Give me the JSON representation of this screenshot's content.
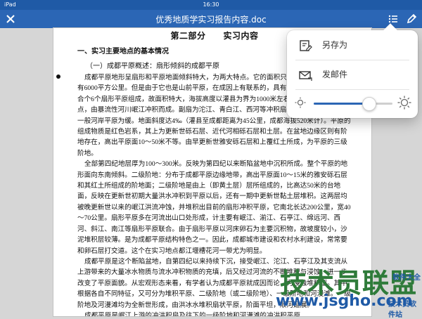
{
  "status_bar": {
    "left": "iPad",
    "time": "16:30",
    "right": ""
  },
  "header": {
    "doc_title": "优秀地质学实习报告内容.doc",
    "icons": [
      "close-icon",
      "list-icon",
      "edit-icon"
    ]
  },
  "document": {
    "part_title": "第二部分　　实习内容",
    "section_title": "一、实习主要地点的基本情况",
    "subsection_title": "（一）成都平原概述：扇形倾斜的成都平原",
    "paragraphs": [
      "成都平原地形呈扇形和平原地面倾斜特大，为两大特点。它的面积只有6000平方公里，只有6000平方公里。但是由于它也是山前平原，在成因上有联系的，具有扇形性质。并且是联合个6个扇形平原组成，故面积特大，海拔高度以灌县为界为1000米左右，西部以灌县县为顶点，由暴流性河川岷江冲积而成。副扇为沱江、青白江、西河等冲积扇组成的，扇形地势较一般河岸平原为缓。地面斜度达4‰（灌县至成都距离为45公里，成都海拔520米计）。平原的组成物质是红色岩系，其上为更新世砾石层、近代河相砾石层和土层。在盆地边缘区则有阶地存在，高出平原面10～50米不等。由早更新世雅安砾石层和上覆红土所成，为平原的三级阶地。",
      "全部第四纪地层厚为100～300米。反映为第四纪以来断陷盆地中沉积所成。整个平原的地形面向东南倾斜。二级阶地：分布于成都平原边缘地带，高出平原面10～15米的雅安砾石层和其红土所组成的阶地面；二级阶地是由上（即黄土层）层所组成的，比高达50米的台地面，反映在更新世初期大量洪水冲积到平原以后，还有一期中更新世黏土层堆积。这两层均被晚更新世以来的岷江洪流冲蚀，并堆积出目前的扇形冲积平原，它南北长达200公里，宽40～70公里。扇形平原多在河流出山口处形成，计主要有岷江、湔江、石亭江、绵远河、西河、斜江、南江等扇形平原联合。由于扇形平原以河床卵石为主要沉积物，故坡度较小，沙泥堆积层较薄。是为成都平原结构特色之一。因此，成都城市建设和农村水利建设，常常要和卵石层打交道。这个在实习地点都江堰槽花河一带尤为明显。",
      "成都平原是这个断陷盆地，自第四纪以来持续下沉，接受岷江、沱江、石亭江及其支流从上游带来的大量冰水物质与流水冲积物质的充填，后又经过河流的不断堆积与浸蚀，进一步改变了平原面貌。从宏观形态来看，有学者认为成都平原就成因而论，为浸蚀堆积型。其中根据各自不同特征，又可分为堆积平原、二级阶地（或二级阶地）、一级阶地和河漫滩。一级阶地及河漫滩均为全新世形成，由洪冰水堆积扇状平原，阶面平坦，顺河延展。",
      "成都平原是岷江上游的冲洪积扇及往下的一级阶地和河漫滩的冲洪积平原"
    ]
  },
  "popover": {
    "items": [
      {
        "label": "另存为",
        "icon": "save-as-icon"
      },
      {
        "label": "发邮件",
        "icon": "mail-icon"
      }
    ],
    "brightness": 0.7,
    "icons": [
      "brightness-low-icon",
      "brightness-high-icon"
    ]
  },
  "watermark": {
    "brand": "技术员联盟",
    "url": "www.jsgho.com",
    "right_text": "软件大全",
    "right_text2": "技术员软件站"
  },
  "colors": {
    "accent": "#2b66b5",
    "status_bar": "#1f5aa6",
    "watermark_green": "#2f7b3a"
  }
}
